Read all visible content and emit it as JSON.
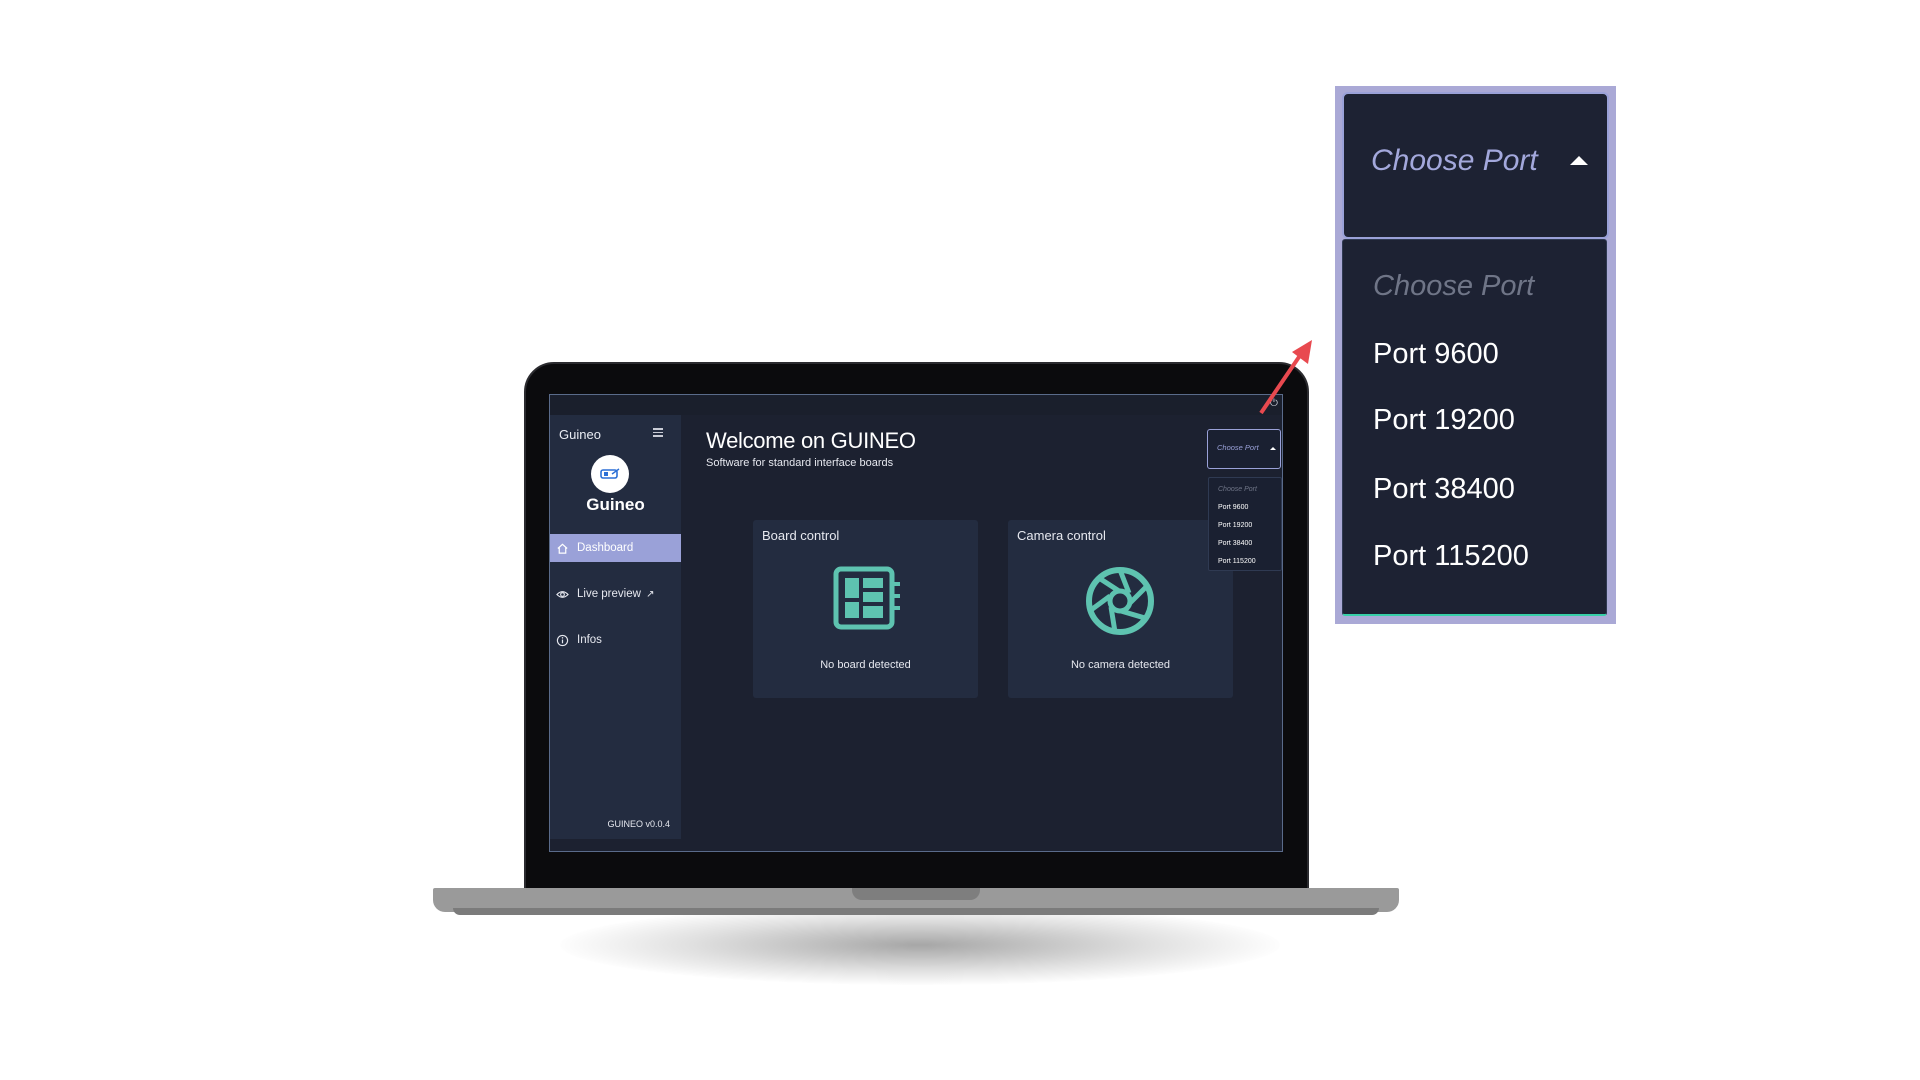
{
  "app": {
    "brand_title": "Guineo",
    "logo_text": "Guineo",
    "version": "GUINEO v0.0.4"
  },
  "sidebar": {
    "items": [
      {
        "label": "Dashboard",
        "icon": "home-icon",
        "active": true
      },
      {
        "label": "Live preview",
        "icon": "eye-icon",
        "active": false
      },
      {
        "label": "Infos",
        "icon": "info-icon",
        "active": false
      }
    ]
  },
  "main": {
    "title": "Welcome on GUINEO",
    "subtitle": "Software for standard interface boards",
    "cards": [
      {
        "title": "Board control",
        "icon": "board-icon",
        "status": "No board detected"
      },
      {
        "title": "Camera control",
        "icon": "camera-shutter-icon",
        "status": "No camera detected"
      }
    ]
  },
  "port_select": {
    "label": "Choose Port",
    "placeholder": "Choose Port",
    "options": [
      "Port 9600",
      "Port 19200",
      "Port 38400",
      "Port 115200"
    ]
  },
  "colors": {
    "accent": "#9aa1d8",
    "teal_icon": "#5ec3b0",
    "background": "#1c2130",
    "panel": "#232c40",
    "callout_arrow": "#e8494f"
  }
}
